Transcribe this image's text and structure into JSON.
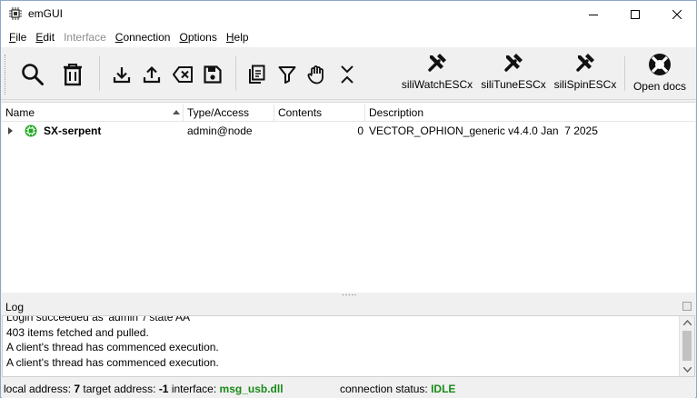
{
  "window": {
    "title": "emGUI"
  },
  "menu": {
    "items": [
      {
        "label_pre": "",
        "mnemonic": "F",
        "label_post": "ile",
        "enabled": true
      },
      {
        "label_pre": "",
        "mnemonic": "E",
        "label_post": "dit",
        "enabled": true
      },
      {
        "label_pre": "",
        "mnemonic": "",
        "label_post": "Interface",
        "enabled": false
      },
      {
        "label_pre": "",
        "mnemonic": "C",
        "label_post": "onnection",
        "enabled": true
      },
      {
        "label_pre": "",
        "mnemonic": "O",
        "label_post": "ptions",
        "enabled": true
      },
      {
        "label_pre": "",
        "mnemonic": "H",
        "label_post": "elp",
        "enabled": true
      }
    ]
  },
  "toolbar": {
    "icons": [
      "search-icon",
      "trash-icon",
      "download-icon",
      "upload-icon",
      "clear-icon",
      "save-icon",
      "copy-icon",
      "filter-icon",
      "hand-icon",
      "collapse-icon"
    ],
    "tools": [
      {
        "label": "siliWatchESCx",
        "icon": "tools-icon"
      },
      {
        "label": "siliTuneESCx",
        "icon": "tools-icon"
      },
      {
        "label": "siliSpinESCx",
        "icon": "tools-icon"
      }
    ],
    "docs": {
      "label": "Open docs",
      "icon": "lifebuoy-icon"
    }
  },
  "tree": {
    "columns": [
      "Name",
      "Type/Access",
      "Contents",
      "Description"
    ],
    "rows": [
      {
        "name": "SX-serpent",
        "type_access": "admin@node",
        "contents": "0",
        "description": "VECTOR_OPHION_generic v4.4.0 Jan  7 2025"
      }
    ]
  },
  "log": {
    "title": "Log",
    "lines": [
      "Login succeeded as 'admin' / state AA",
      "403 items fetched and pulled.",
      "A client's thread has commenced execution.",
      "A client's thread has commenced execution."
    ]
  },
  "status": {
    "local_label": "local address:",
    "local_value": "7",
    "target_label": "target address:",
    "target_value": "-1",
    "interface_label": "interface:",
    "interface_value": "msg_usb.dll",
    "conn_label": "connection status:",
    "conn_value": "IDLE"
  },
  "colors": {
    "status_green": "#1a8a1a",
    "node_green": "#22aa22"
  }
}
